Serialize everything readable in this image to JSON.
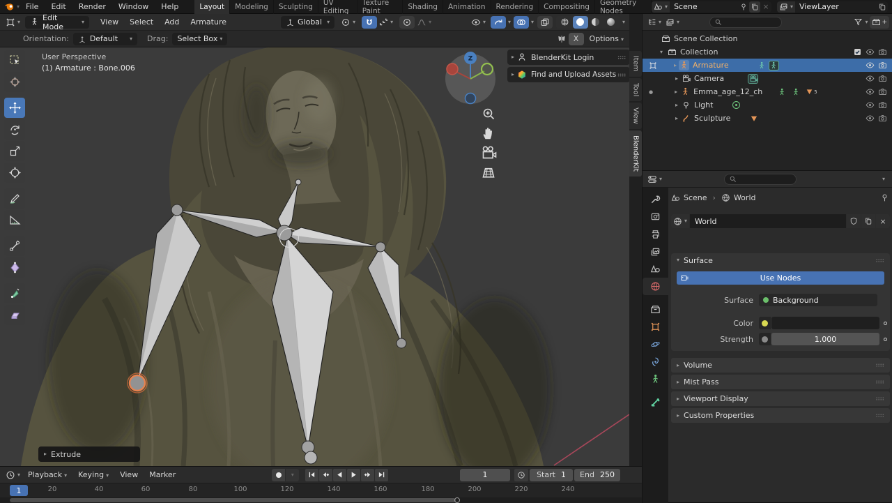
{
  "topbar": {
    "menus": [
      "File",
      "Edit",
      "Render",
      "Window",
      "Help"
    ],
    "workspaces": [
      "Layout",
      "Modeling",
      "Sculpting",
      "UV Editing",
      "Texture Paint",
      "Shading",
      "Animation",
      "Rendering",
      "Compositing",
      "Geometry Nodes"
    ],
    "scene_value": "Scene",
    "viewlayer_value": "ViewLayer"
  },
  "tool_header": {
    "mode_value": "Edit Mode",
    "menus": [
      "View",
      "Select",
      "Add",
      "Armature"
    ],
    "orientation_value": "Global",
    "options_label": "Options"
  },
  "tool_settings": {
    "orientation_label": "Orientation:",
    "orientation_value": "Default",
    "drag_label": "Drag:",
    "drag_value": "Select Box",
    "mirror_label": "X"
  },
  "viewport": {
    "view_label": "User Perspective",
    "active_label": "(1) Armature : Bone.006",
    "gizmo_z": "Z",
    "operator_label": "Extrude",
    "tabs": [
      "Item",
      "Tool",
      "View",
      "BlenderKit"
    ],
    "panels": [
      "BlenderKit Login",
      "Find and Upload Assets"
    ]
  },
  "outliner": {
    "scene_collection": "Scene Collection",
    "collection": "Collection",
    "objects": [
      "Armature",
      "Camera",
      "Emma_age_12_ch",
      "Light",
      "Sculpture"
    ],
    "emma_badge": "5"
  },
  "properties": {
    "breadcrumb_scene": "Scene",
    "breadcrumb_sep": "›",
    "breadcrumb_world": "World",
    "world_name": "World",
    "surface_title": "Surface",
    "use_nodes": "Use Nodes",
    "surface_label": "Surface",
    "surface_value": "Background",
    "color_label": "Color",
    "strength_label": "Strength",
    "strength_value": "1.000",
    "panels": [
      "Volume",
      "Mist Pass",
      "Viewport Display",
      "Custom Properties"
    ]
  },
  "timeline": {
    "menus": [
      "Playback",
      "Keying",
      "View",
      "Marker"
    ],
    "frame_current": "1",
    "start_label": "Start",
    "start_value": "1",
    "end_label": "End",
    "end_value": "250",
    "ticks": [
      "20",
      "40",
      "60",
      "80",
      "100",
      "120",
      "140",
      "160",
      "180",
      "200",
      "220",
      "240"
    ],
    "playhead": "1"
  },
  "colors": {
    "accent": "#4772b3",
    "selection_row": "#3d6da8",
    "active_object_text": "#f0b06a",
    "viewport_bg": "#3b3b3b",
    "selected_joint": "#e0703c",
    "axis_pink": "#a8475a",
    "statue_base": "#56533f"
  }
}
